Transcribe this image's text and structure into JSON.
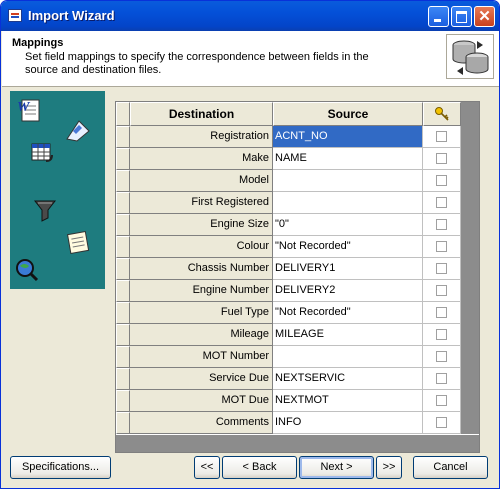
{
  "window": {
    "title": "Import Wizard"
  },
  "header": {
    "title": "Mappings",
    "description": "Set field mappings to specify the correspondence between fields in the source and destination files."
  },
  "grid": {
    "columns": {
      "destination": "Destination",
      "source": "Source",
      "key_icon": "key-icon"
    },
    "rows": [
      {
        "destination": "Registration",
        "source": "ACNT_NO",
        "selected": true,
        "key": false
      },
      {
        "destination": "Make",
        "source": "NAME",
        "key": false
      },
      {
        "destination": "Model",
        "source": "",
        "key": false
      },
      {
        "destination": "First Registered",
        "source": "",
        "key": false
      },
      {
        "destination": "Engine Size",
        "source": "\"0\"",
        "key": false
      },
      {
        "destination": "Colour",
        "source": "\"Not Recorded\"",
        "key": false
      },
      {
        "destination": "Chassis Number",
        "source": "DELIVERY1",
        "key": false
      },
      {
        "destination": "Engine Number",
        "source": "DELIVERY2",
        "key": false
      },
      {
        "destination": "Fuel Type",
        "source": "\"Not Recorded\"",
        "key": false
      },
      {
        "destination": "Mileage",
        "source": "MILEAGE",
        "key": false
      },
      {
        "destination": "MOT Number",
        "source": "",
        "key": false
      },
      {
        "destination": "Service Due",
        "source": "NEXTSERVIC",
        "key": false
      },
      {
        "destination": "MOT Due",
        "source": "NEXTMOT",
        "key": false
      },
      {
        "destination": "Comments",
        "source": "INFO",
        "key": false
      }
    ]
  },
  "buttons": {
    "specifications": "Specifications...",
    "first": "<<",
    "back": "< Back",
    "next": "Next >",
    "last": ">>",
    "cancel": "Cancel"
  },
  "colors": {
    "titlebar": "#0450D8",
    "side_panel": "#1E7C7F",
    "selection": "#316AC5"
  }
}
